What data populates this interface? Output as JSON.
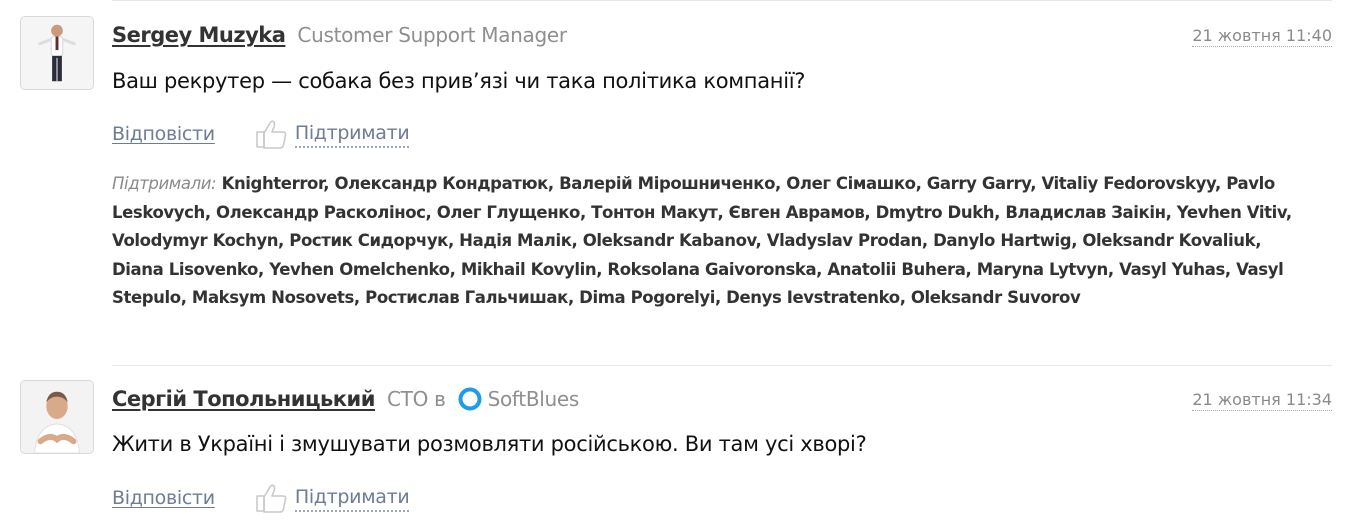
{
  "comments": [
    {
      "author": "Sergey Muzyka",
      "position": "Customer Support Manager",
      "company": "",
      "date": "21 жовтня 11:40",
      "text": "Ваш рекрутер — собака без прив’язі чи така політика компанії?",
      "reply_label": "Відповісти",
      "support_label": "Підтримати",
      "supporters_label": "Підтримали:",
      "supporters": "Knighterror, Олександр Кондратюк, Валерій Мірошниченко, Олег Сімашко, Garry Garry, Vitaliy Fedorovskyy, Pavlo Leskovych, Олександр Расколінос, Олег Глущенко, Тонтон Макут, Євген Аврамов, Dmytro Dukh, Владислав Заікін, Yevhen Vitiv, Volodymyr Kochyn, Ростик Сидорчук, Надія Малік, Oleksandr Kabanov, Vladyslav Prodan, Danylo Hartwig, Oleksandr Kovaliuk, Diana Lisovenko, Yevhen Omelchenko, Mikhail Kovylin, Roksolana Gaivoronska, Anatolii Buhera, Maryna Lytvyn, Vasyl Yuhas, Vasyl Stepulo, Maksym Nosovets, Ростислав Гальчишак, Dima Pogorelyi, Denys Ievstratenko, Oleksandr Suvorov"
    },
    {
      "author": "Сергій Топольницький",
      "position": "CTO в",
      "company": "SoftBlues",
      "date": "21 жовтня 11:34",
      "text": "Жити в Україні і змушувати розмовляти російською. Ви там усі хворі?",
      "reply_label": "Відповісти",
      "support_label": "Підтримати"
    }
  ],
  "colors": {
    "link": "#6d7d94",
    "muted": "#8f8f8f",
    "company_logo": "#1e9be9"
  }
}
